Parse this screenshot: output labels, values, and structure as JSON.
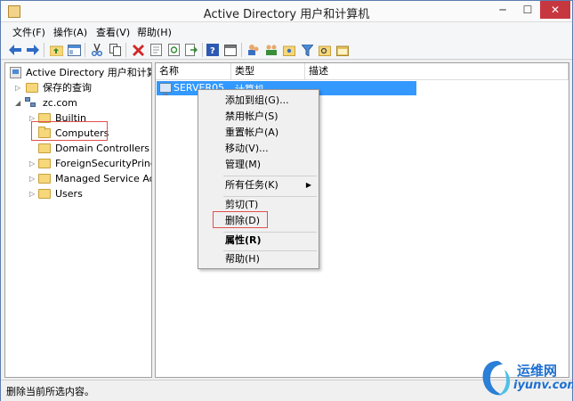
{
  "window": {
    "title": "Active Directory 用户和计算机",
    "minimize": "─",
    "maximize": "☐",
    "close": "✕"
  },
  "menu": {
    "items": [
      "文件(F)",
      "操作(A)",
      "查看(V)",
      "帮助(H)"
    ]
  },
  "toolbar": {
    "icons": [
      "back-arrow-icon",
      "forward-arrow-icon",
      "folder-up-icon",
      "view-icon",
      "cut-icon",
      "copy-icon",
      "delete-icon",
      "properties-icon",
      "refresh-icon",
      "export-icon",
      "help-icon",
      "console-icon",
      "users-icon",
      "group-icon",
      "filter-icon",
      "find-icon",
      "container-icon"
    ]
  },
  "tree": {
    "root": "Active Directory 用户和计算机",
    "saved_queries": "保存的查询",
    "domain": "zc.com",
    "children": [
      "Builtin",
      "Computers",
      "Domain Controllers",
      "ForeignSecurityPrincipa",
      "Managed Service Acco",
      "Users"
    ]
  },
  "list": {
    "columns": [
      "名称",
      "类型",
      "描述"
    ],
    "rows": [
      {
        "name": "SERVER05",
        "type": "计算机",
        "description": ""
      }
    ]
  },
  "context_menu": {
    "items": [
      {
        "label": "添加到组(G)..."
      },
      {
        "label": "禁用帐户(S)"
      },
      {
        "label": "重置帐户(A)"
      },
      {
        "label": "移动(V)..."
      },
      {
        "label": "管理(M)"
      },
      {
        "label": "所有任务(K)",
        "submenu": "▶"
      },
      {
        "label": "剪切(T)"
      },
      {
        "label": "删除(D)"
      },
      {
        "label": "属性(R)"
      },
      {
        "label": "帮助(H)"
      }
    ]
  },
  "status": {
    "text": "删除当前所选内容。"
  },
  "watermark": {
    "cn": "运维网",
    "en": "iyunv.com"
  },
  "colors": {
    "selection": "#3399ff",
    "highlight_box": "#e05050",
    "watermark": "#1e6fd0"
  }
}
